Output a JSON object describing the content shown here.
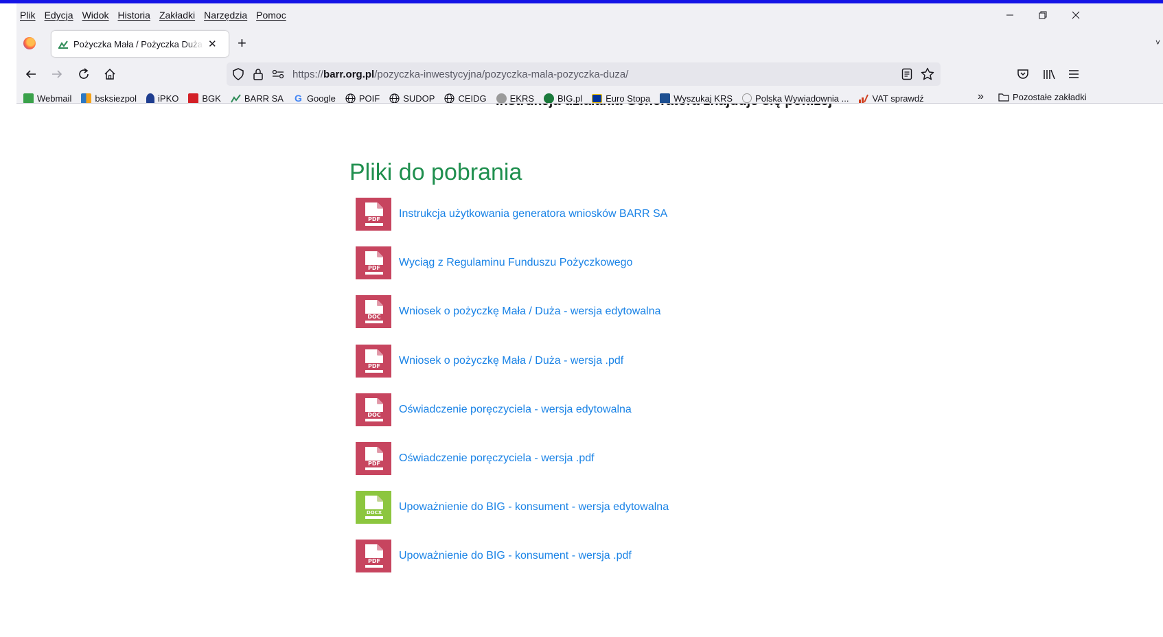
{
  "menu": [
    "Plik",
    "Edycja",
    "Widok",
    "Historia",
    "Zakładki",
    "Narzędzia",
    "Pomoc"
  ],
  "window_controls": {
    "minimize": "—",
    "restore": "❐",
    "close": "✕"
  },
  "tab": {
    "title": "Pożyczka Mała / Pożyczka Duża",
    "close": "✕",
    "new_tab": "+"
  },
  "url": {
    "protocol": "https://",
    "domain": "barr.org.pl",
    "path": "/pozyczka-inwestycyjna/pozyczka-mala-pozyczka-duza/"
  },
  "bookmarks": [
    {
      "label": "Webmail",
      "icon": "webmail-icon",
      "color": "#3aa14a"
    },
    {
      "label": "bsksiezpol",
      "icon": "bank-grid-icon",
      "color": "#2b78c5"
    },
    {
      "label": "iPKO",
      "icon": "pko-icon",
      "color": "#1e3d8f"
    },
    {
      "label": "BGK",
      "icon": "bgk-icon",
      "color": "#d32027"
    },
    {
      "label": "BARR SA",
      "icon": "barr-icon",
      "color": "#2e8b57"
    },
    {
      "label": "Google",
      "icon": "google-icon",
      "color": "#4285f4"
    },
    {
      "label": "POIF",
      "icon": "globe-icon",
      "color": "#15141a"
    },
    {
      "label": "SUDOP",
      "icon": "globe-icon",
      "color": "#15141a"
    },
    {
      "label": "CEIDG",
      "icon": "globe-icon",
      "color": "#15141a"
    },
    {
      "label": "EKRS",
      "icon": "eagle-icon",
      "color": "#7a7a7a"
    },
    {
      "label": "BIG.pl",
      "icon": "big-icon",
      "color": "#1b7a3c"
    },
    {
      "label": "Euro Stopa",
      "icon": "eu-flag-icon",
      "color": "#003399"
    },
    {
      "label": "Wyszukaj KRS",
      "icon": "krs-icon",
      "color": "#1d4f91"
    },
    {
      "label": "Polska Wywiadownia ...",
      "icon": "wywiadownia-icon",
      "color": "#9a9a9a"
    },
    {
      "label": "VAT sprawdź",
      "icon": "vat-icon",
      "color": "#d04020"
    }
  ],
  "bookmarks_overflow": "»",
  "other_bookmarks": "Pozostałe zakładki",
  "page": {
    "cut_heading": "Instrukcja działania Generatora znajduje się poniżej",
    "section_title": "Pliki do pobrania",
    "files": [
      {
        "label": "Instrukcja użytkowania generatora wniosków BARR SA",
        "type": "PDF",
        "color": "#c7455f"
      },
      {
        "label": "Wyciąg z Regulaminu Funduszu Pożyczkowego",
        "type": "PDF",
        "color": "#c7455f"
      },
      {
        "label": "Wniosek o pożyczkę Mała / Duża - wersja edytowalna",
        "type": "DOC",
        "color": "#c7455f"
      },
      {
        "label": "Wniosek o pożyczkę Mała / Duża - wersja .pdf",
        "type": "PDF",
        "color": "#c7455f"
      },
      {
        "label": "Oświadczenie poręczyciela - wersja edytowalna",
        "type": "DOC",
        "color": "#c7455f"
      },
      {
        "label": "Oświadczenie poręczyciela - wersja .pdf",
        "type": "PDF",
        "color": "#c7455f"
      },
      {
        "label": "Upoważnienie do BIG - konsument - wersja edytowalna",
        "type": "DOCX",
        "color": "#8cc63f"
      },
      {
        "label": "Upoważnienie do BIG - konsument - wersja .pdf",
        "type": "PDF",
        "color": "#c7455f"
      }
    ]
  }
}
